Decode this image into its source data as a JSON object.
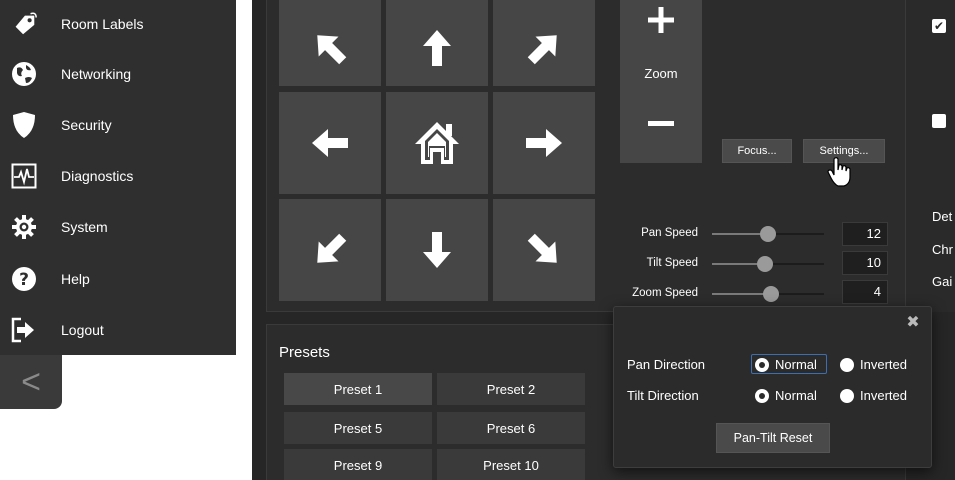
{
  "sidebar": {
    "items": [
      {
        "label": "Room Labels",
        "icon": "tag-icon"
      },
      {
        "label": "Networking",
        "icon": "globe-icon"
      },
      {
        "label": "Security",
        "icon": "shield-icon"
      },
      {
        "label": "Diagnostics",
        "icon": "pulse-icon"
      },
      {
        "label": "System",
        "icon": "gear-icon"
      },
      {
        "label": "Help",
        "icon": "question-icon"
      },
      {
        "label": "Logout",
        "icon": "logout-icon"
      }
    ],
    "collapse_glyph": "<"
  },
  "ptz": {
    "zoom_label": "Zoom",
    "focus_button": "Focus...",
    "settings_button": "Settings...",
    "speeds": [
      {
        "label": "Pan Speed",
        "value": "12",
        "fraction": 0.5
      },
      {
        "label": "Tilt Speed",
        "value": "10",
        "fraction": 0.47
      },
      {
        "label": "Zoom Speed",
        "value": "4",
        "fraction": 0.53
      }
    ]
  },
  "right_column": {
    "labels": [
      "Det",
      "Chr",
      "Gai"
    ],
    "checkbox1_checked": true,
    "checkbox2_checked": false
  },
  "presets": {
    "title": "Presets",
    "rows": [
      [
        "Preset 1",
        "Preset 2"
      ],
      [
        "Preset 5",
        "Preset 6"
      ],
      [
        "Preset 9",
        "Preset 10"
      ]
    ],
    "selected": "Preset 1"
  },
  "popup": {
    "pan_direction_label": "Pan Direction",
    "tilt_direction_label": "Tilt Direction",
    "normal_label": "Normal",
    "inverted_label": "Inverted",
    "pan_selected": "Normal",
    "tilt_selected": "Normal",
    "reset_button": "Pan-Tilt Reset",
    "close_glyph": "✖"
  },
  "colors": {
    "sidebar_bg": "#2f2f2f",
    "panel_bg": "#2c2c2c",
    "button_bg": "#464646",
    "focus_ring": "#3b6fb0"
  }
}
